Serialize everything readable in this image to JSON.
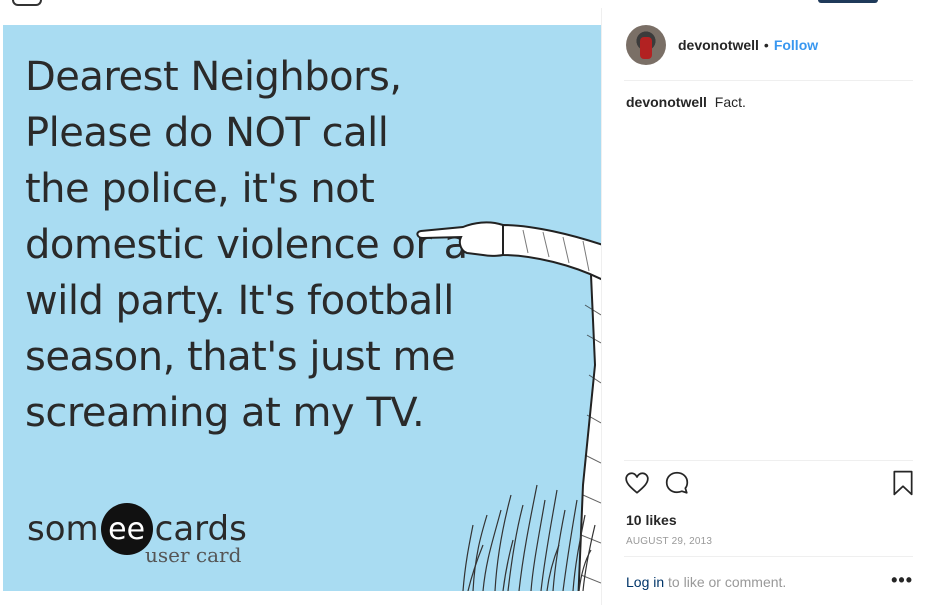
{
  "post": {
    "card": {
      "lines": [
        "Dearest Neighbors,",
        "Please do NOT call",
        "the police, it's not",
        "domestic violence or a",
        "wild party. It's football",
        "season, that's just me",
        "screaming at my TV."
      ],
      "brand_left": "som",
      "brand_badge": "ee",
      "brand_right": "cards",
      "brand_sub": "user card",
      "background_color": "#a9dcf2"
    },
    "header": {
      "username": "devonotwell",
      "separator": "•",
      "follow_label": "Follow"
    },
    "caption": {
      "username": "devonotwell",
      "text": "Fact."
    },
    "stats": {
      "likes": "10 likes",
      "date": "AUGUST 29, 2013"
    },
    "footer": {
      "login_link": "Log in",
      "login_rest": " to like or comment.",
      "more": "•••"
    },
    "icons": {
      "like": "heart-icon",
      "comment": "comment-icon",
      "save": "bookmark-icon",
      "more": "more-options-icon"
    },
    "colors": {
      "link_blue": "#3897f0",
      "login_link": "#003569",
      "muted": "#999999"
    }
  }
}
